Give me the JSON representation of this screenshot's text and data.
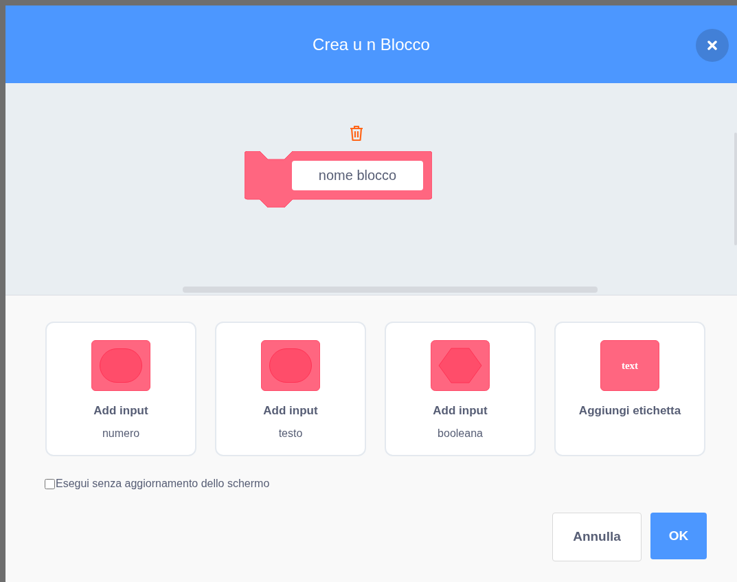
{
  "dialog": {
    "title": "Crea u n Blocco"
  },
  "block": {
    "name_placeholder": "nome blocco"
  },
  "options": [
    {
      "kind": "number",
      "title": "Add input",
      "subtitle": "numero"
    },
    {
      "kind": "text",
      "title": "Add input",
      "subtitle": "testo"
    },
    {
      "kind": "boolean",
      "title": "Add input",
      "subtitle": "booleana"
    },
    {
      "kind": "label",
      "title": "Aggiungi etichetta",
      "icon_text": "text"
    }
  ],
  "run_without_refresh": {
    "label": "Esegui senza aggiornamento dello schermo",
    "checked": false
  },
  "buttons": [
    {
      "kind": "cancel",
      "label": "Annulla"
    },
    {
      "kind": "ok",
      "label": "OK"
    }
  ]
}
